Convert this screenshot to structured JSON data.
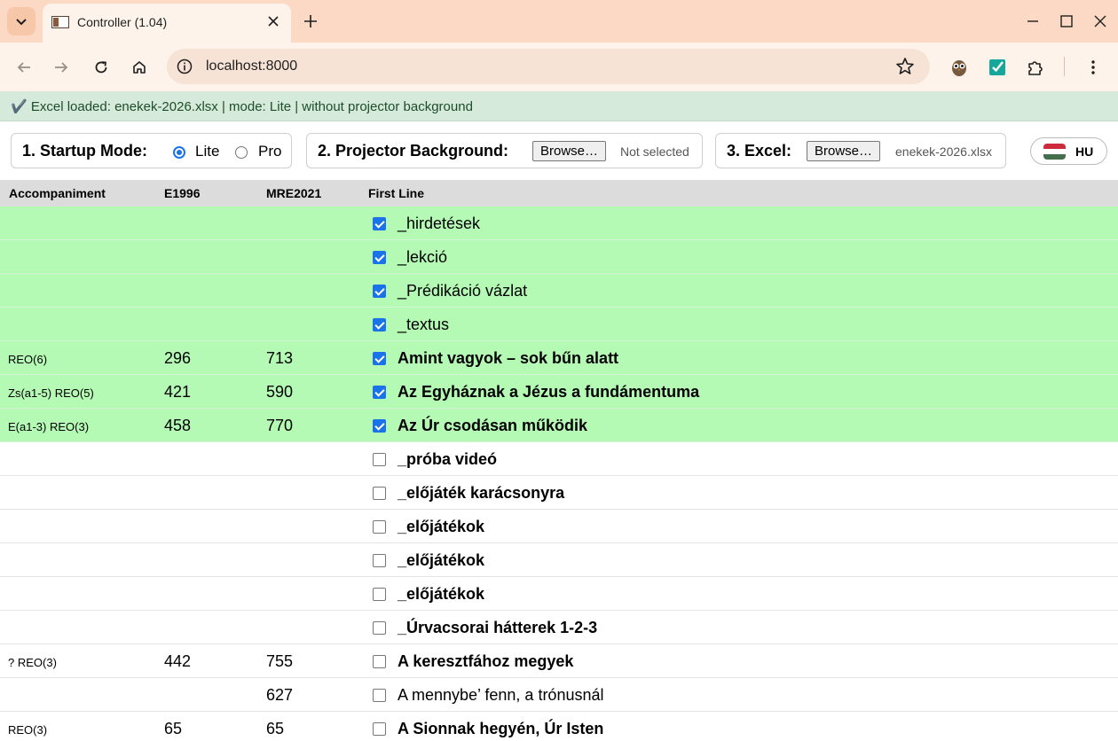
{
  "browser": {
    "tab_title": "Controller (1.04)",
    "url": "localhost:8000"
  },
  "status": {
    "text": "✔️ Excel loaded: enekek-2026.xlsx | mode: Lite | without projector background"
  },
  "controls": {
    "startup_label": "1. Startup Mode:",
    "mode_lite": "Lite",
    "mode_pro": "Pro",
    "selected_mode": "Lite",
    "background_label": "2. Projector Background:",
    "background_browse": "Browse…",
    "background_file": "Not selected",
    "excel_label": "3. Excel:",
    "excel_browse": "Browse…",
    "excel_file": "enekek-2026.xlsx",
    "language": "HU"
  },
  "table": {
    "headers": {
      "accompaniment": "Accompaniment",
      "e1996": "E1996",
      "mre2021": "MRE2021",
      "first_line": "First Line"
    },
    "rows": [
      {
        "acc": "",
        "e1996": "",
        "mre2021": "",
        "title": "_hirdetések",
        "checked": true,
        "bold": false
      },
      {
        "acc": "",
        "e1996": "",
        "mre2021": "",
        "title": "_lekció",
        "checked": true,
        "bold": false
      },
      {
        "acc": "",
        "e1996": "",
        "mre2021": "",
        "title": "_Prédikáció vázlat",
        "checked": true,
        "bold": false
      },
      {
        "acc": "",
        "e1996": "",
        "mre2021": "",
        "title": "_textus",
        "checked": true,
        "bold": false
      },
      {
        "acc": "REO(6)",
        "e1996": "296",
        "mre2021": "713",
        "title": "Amint vagyok – sok bűn alatt",
        "checked": true,
        "bold": true
      },
      {
        "acc": "Zs(a1-5) REO(5)",
        "e1996": "421",
        "mre2021": "590",
        "title": "Az Egyháznak a Jézus a fundámentuma",
        "checked": true,
        "bold": true
      },
      {
        "acc": "E(a1-3) REO(3)",
        "e1996": "458",
        "mre2021": "770",
        "title": "Az Úr csodásan működik",
        "checked": true,
        "bold": true
      },
      {
        "acc": "",
        "e1996": "",
        "mre2021": "",
        "title": "_próba videó",
        "checked": false,
        "bold": true
      },
      {
        "acc": "",
        "e1996": "",
        "mre2021": "",
        "title": "_előjáték karácsonyra",
        "checked": false,
        "bold": true
      },
      {
        "acc": "",
        "e1996": "",
        "mre2021": "",
        "title": "_előjátékok",
        "checked": false,
        "bold": true
      },
      {
        "acc": "",
        "e1996": "",
        "mre2021": "",
        "title": "_előjátékok",
        "checked": false,
        "bold": true
      },
      {
        "acc": "",
        "e1996": "",
        "mre2021": "",
        "title": "_előjátékok",
        "checked": false,
        "bold": true
      },
      {
        "acc": "",
        "e1996": "",
        "mre2021": "",
        "title": "_Úrvacsorai hátterek 1-2-3",
        "checked": false,
        "bold": true
      },
      {
        "acc": "? REO(3)",
        "e1996": "442",
        "mre2021": "755",
        "title": "A keresztfához megyek",
        "checked": false,
        "bold": true
      },
      {
        "acc": "",
        "e1996": "",
        "mre2021": "627",
        "title": "A mennybe’ fenn, a trónusnál",
        "checked": false,
        "bold": false
      },
      {
        "acc": "REO(3)",
        "e1996": "65",
        "mre2021": "65",
        "title": "A Sionnak hegyén, Úr Isten",
        "checked": false,
        "bold": true
      }
    ]
  },
  "colors": {
    "selected_row": "#b4f9b4",
    "status_bg": "#d5eadb",
    "tabstrip_bg": "#fbd9c4"
  }
}
